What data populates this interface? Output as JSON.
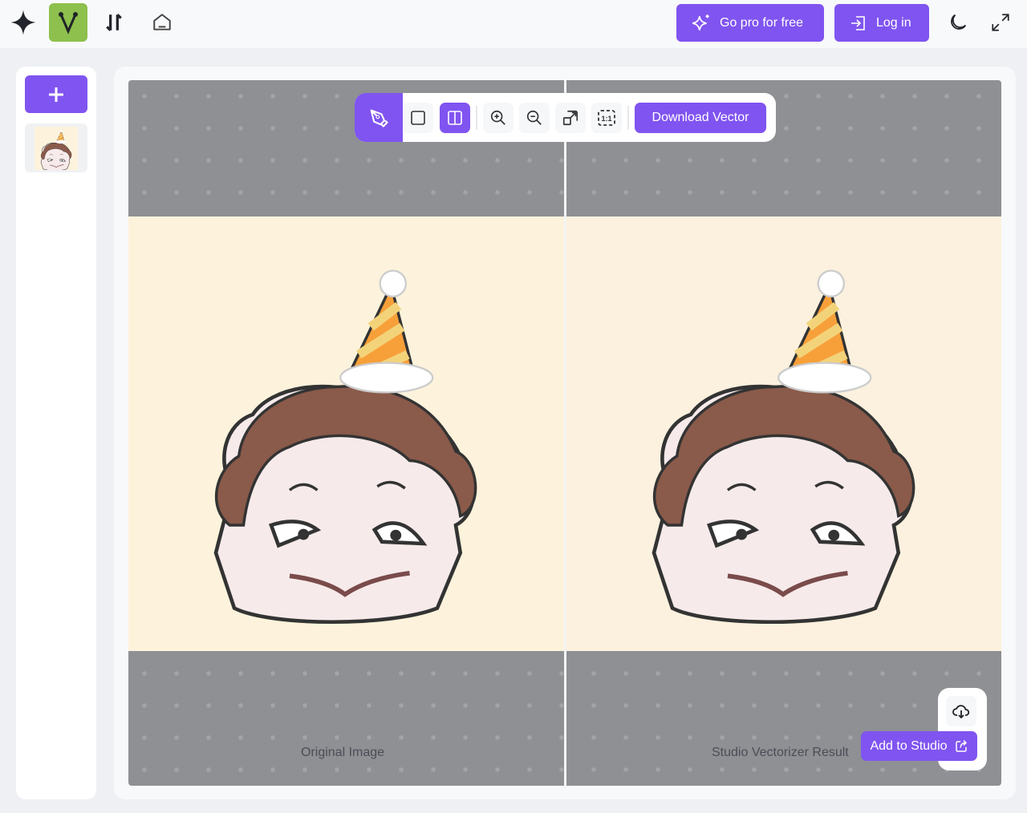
{
  "header": {
    "logo_letter": "V",
    "go_pro_label": "Go pro for free",
    "login_label": "Log in",
    "colors": {
      "accent": "#8054f0",
      "logo_bg": "#8dc04c"
    }
  },
  "toolbar": {
    "download_label": "Download Vector",
    "icons": [
      "pen-tool-icon",
      "single-view-icon",
      "split-view-icon",
      "zoom-in-icon",
      "zoom-out-icon",
      "fit-icon",
      "actual-size-icon"
    ],
    "actual_size_text": "1:1"
  },
  "canvas": {
    "left_label": "Original Image",
    "right_label": "Studio Vectorizer Result"
  },
  "actions": {
    "add_to_studio_label": "Add to Studio"
  }
}
